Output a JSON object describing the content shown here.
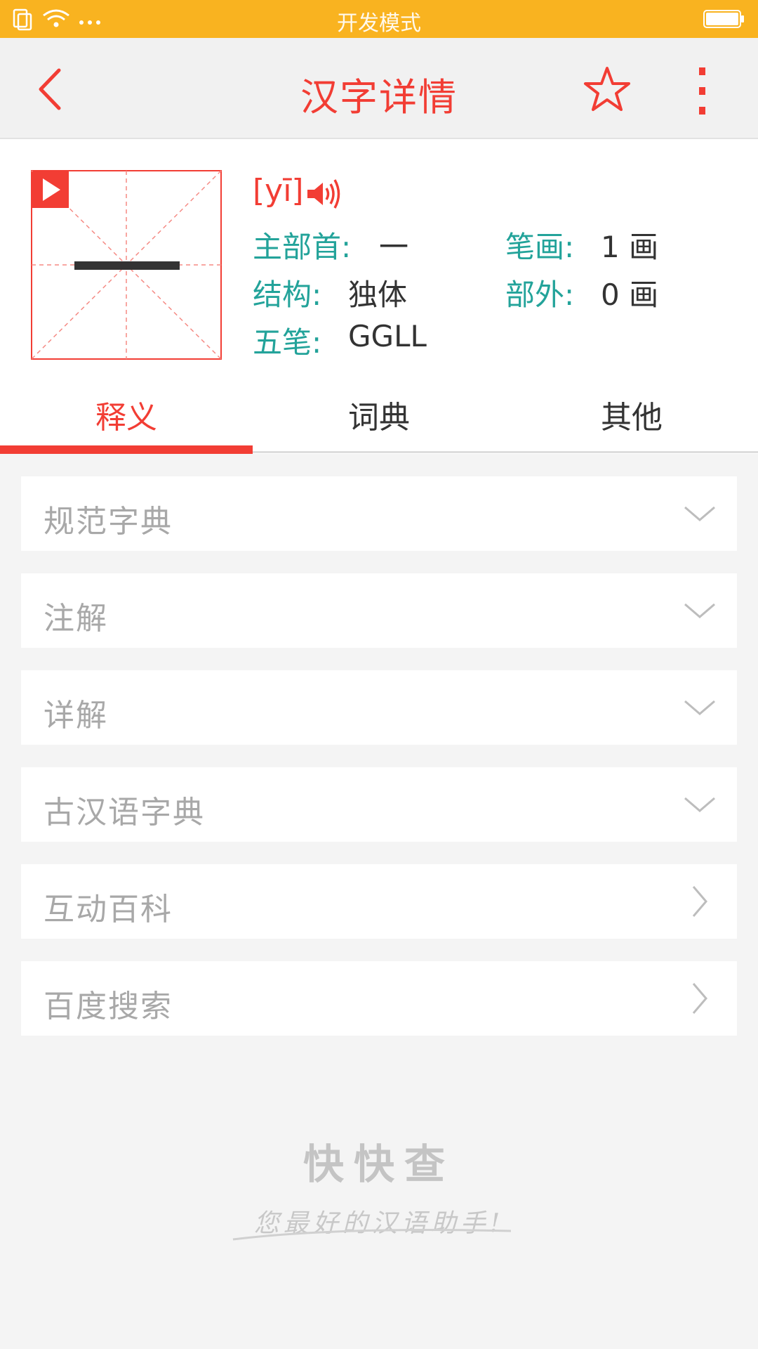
{
  "status_bar": {
    "title": "开发模式"
  },
  "header": {
    "title": "汉字详情"
  },
  "character": {
    "glyph": "一",
    "pinyin": "[yī]",
    "radical_label": "主部首:",
    "radical_value": "一",
    "strokes_label": "笔画:",
    "strokes_value": "1 画",
    "structure_label": "结构:",
    "structure_value": "独体",
    "outside_label": "部外:",
    "outside_value": "0 画",
    "wubi_label": "五笔:",
    "wubi_value": "GGLL"
  },
  "tabs": [
    {
      "label": "释义",
      "active": true
    },
    {
      "label": "词典",
      "active": false
    },
    {
      "label": "其他",
      "active": false
    }
  ],
  "sections": [
    {
      "label": "规范字典",
      "arrow": "chevron-down-icon"
    },
    {
      "label": "注解",
      "arrow": "chevron-down-icon"
    },
    {
      "label": "详解",
      "arrow": "chevron-down-icon"
    },
    {
      "label": "古汉语字典",
      "arrow": "chevron-down-icon"
    },
    {
      "label": "互动百科",
      "arrow": "chevron-right-icon"
    },
    {
      "label": "百度搜索",
      "arrow": "chevron-right-icon"
    }
  ],
  "footer": {
    "brand": "快快查",
    "slogan": "您最好的汉语助手!"
  },
  "colors": {
    "accent": "#f23d34",
    "label_teal": "#23a39a",
    "status_bar": "#f9b320"
  }
}
